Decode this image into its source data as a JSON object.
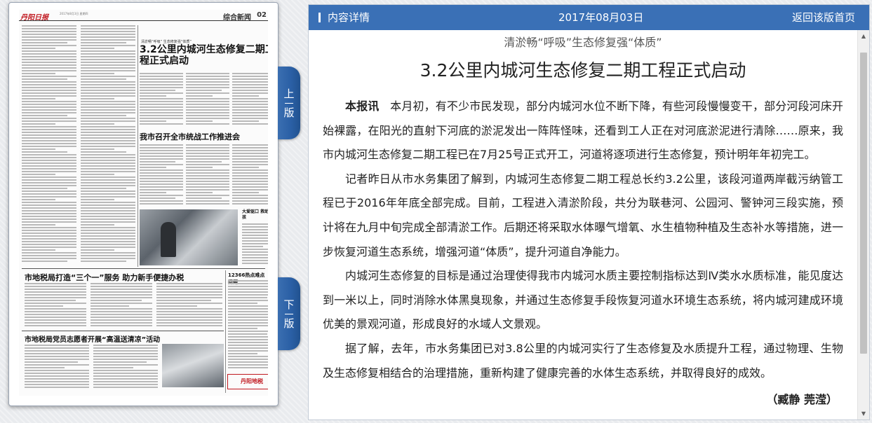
{
  "newspaper": {
    "masthead": "丹阳日报",
    "date_line": "2017年8月3日 星期四",
    "section": "综合新闻",
    "page_number": "02",
    "kicker": "清淤畅“呼吸” 生态修复强“体质”",
    "headline": "3.2公里内城河生态修复二期工程正式启动",
    "headline2": "我市召开全市统战工作推进会",
    "headline3": "市地税局打造“三个一”服务 助力新手便捷办税",
    "headline4": "市地税局党员志愿者开展“高温送清凉”活动",
    "box_title": "12366热点难点问题",
    "side_title": "大爱驱口 救助女孩",
    "ad_text": "丹阳地税"
  },
  "tabs": {
    "prev": [
      "上",
      "版"
    ],
    "next": [
      "下",
      "版"
    ]
  },
  "header": {
    "left_label": "内容详情",
    "date": "2017年08月03日",
    "back_label": "返回该版首页"
  },
  "article": {
    "subtitle": "清淤畅“呼吸”生态修复强“体质”",
    "title": "3.2公里内城河生态修复二期工程正式启动",
    "lead_label": "本报讯",
    "paragraph1": "本月初，有不少市民发现，部分内城河水位不断下降，有些河段慢慢变干，部分河段河床开始裸露，在阳光的直射下河底的淤泥发出一阵阵怪味，还看到工人正在对河底淤泥进行清除……原来，我市内城河生态修复二期工程已在7月25号正式开工，河道将逐项进行生态修复，预计明年年初完工。",
    "paragraph2": "记者昨日从市水务集团了解到，内城河生态修复二期工程总长约3.2公里，该段河道两岸截污纳管工程已于2016年年底全部完成。目前，工程进入清淤阶段，共分为联巷河、公园河、警钟河三段实施，预计将在九月中旬完成全部清淤工作。后期还将采取水体曝气增氧、水生植物种植及生态补水等措施，进一步恢复河道生态系统，增强河道“体质”，提升河道自净能力。",
    "paragraph3": "内城河生态修复的目标是通过治理使得我市内城河水质主要控制指标达到Ⅳ类水水质标准，能见度达到一米以上，同时消除水体黑臭现象，并通过生态修复手段恢复河道水环境生态系统，将内城河建成环境优美的景观河道，形成良好的水域人文景观。",
    "paragraph4": "据了解，去年，市水务集团已对3.8公里的内城河实行了生态修复及水质提升工程，通过物理、生物及生态修复相结合的治理措施，重新构建了健康完善的水体生态系统，并取得良好的成效。",
    "byline": "（臧静 莞滢）"
  },
  "colors": {
    "header_bg": "#3a70b6",
    "tab_bg": "#2a5fa5",
    "masthead_red": "#c0181f"
  }
}
